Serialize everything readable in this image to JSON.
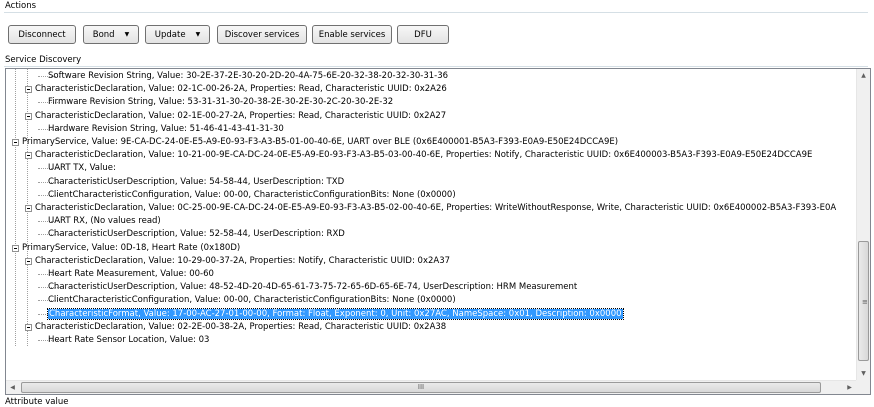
{
  "actions": {
    "label": "Actions",
    "buttons": {
      "disconnect": "Disconnect",
      "bond": "Bond",
      "update": "Update",
      "discover": "Discover services",
      "enable": "Enable services",
      "dfu": "DFU"
    }
  },
  "service_discovery": {
    "label": "Service Discovery",
    "tree": [
      {
        "level": 3,
        "text": "Software Revision String, Value: 30-2E-37-2E-30-20-2D-20-4A-75-6E-20-32-38-20-32-30-31-36",
        "toggle": false
      },
      {
        "level": 2,
        "text": "CharacteristicDeclaration, Value: 02-1C-00-26-2A, Properties: Read, Characteristic UUID: 0x2A26",
        "toggle": true
      },
      {
        "level": 3,
        "text": "Firmware Revision String, Value: 53-31-31-30-20-38-2E-30-2E-30-2C-20-30-2E-32",
        "toggle": false
      },
      {
        "level": 2,
        "text": "CharacteristicDeclaration, Value: 02-1E-00-27-2A, Properties: Read, Characteristic UUID: 0x2A27",
        "toggle": true
      },
      {
        "level": 3,
        "text": "Hardware Revision String, Value: 51-46-41-43-41-31-30",
        "toggle": false
      },
      {
        "level": 1,
        "text": "PrimaryService, Value: 9E-CA-DC-24-0E-E5-A9-E0-93-F3-A3-B5-01-00-40-6E, UART over BLE (0x6E400001-B5A3-F393-E0A9-E50E24DCCA9E)",
        "toggle": true
      },
      {
        "level": 2,
        "text": "CharacteristicDeclaration, Value: 10-21-00-9E-CA-DC-24-0E-E5-A9-E0-93-F3-A3-B5-03-00-40-6E, Properties: Notify, Characteristic UUID: 0x6E400003-B5A3-F393-E0A9-E50E24DCCA9E",
        "toggle": true
      },
      {
        "level": 3,
        "text": "UART TX, Value:",
        "toggle": false
      },
      {
        "level": 3,
        "text": "CharacteristicUserDescription, Value: 54-58-44, UserDescription: TXD",
        "toggle": false
      },
      {
        "level": 3,
        "text": "ClientCharacteristicConfiguration, Value: 00-00, CharacteristicConfigurationBits: None (0x0000)",
        "toggle": false
      },
      {
        "level": 2,
        "text": "CharacteristicDeclaration, Value: 0C-25-00-9E-CA-DC-24-0E-E5-A9-E0-93-F3-A3-B5-02-00-40-6E, Properties: WriteWithoutResponse, Write, Characteristic UUID: 0x6E400002-B5A3-F393-E0A",
        "toggle": true
      },
      {
        "level": 3,
        "text": "UART RX, (No values read)",
        "toggle": false
      },
      {
        "level": 3,
        "text": "CharacteristicUserDescription, Value: 52-58-44, UserDescription: RXD",
        "toggle": false
      },
      {
        "level": 1,
        "text": "PrimaryService, Value: 0D-18, Heart Rate (0x180D)",
        "toggle": true
      },
      {
        "level": 2,
        "text": "CharacteristicDeclaration, Value: 10-29-00-37-2A, Properties: Notify, Characteristic UUID: 0x2A37",
        "toggle": true
      },
      {
        "level": 3,
        "text": "Heart Rate Measurement, Value: 00-60",
        "toggle": false
      },
      {
        "level": 3,
        "text": "CharacteristicUserDescription, Value: 48-52-4D-20-4D-65-61-73-75-72-65-6D-65-6E-74, UserDescription: HRM Measurement",
        "toggle": false
      },
      {
        "level": 3,
        "text": "ClientCharacteristicConfiguration, Value: 00-00, CharacteristicConfigurationBits: None (0x0000)",
        "toggle": false
      },
      {
        "level": 3,
        "text": "CharacteristicFormat, Value: 17-00-AC-27-01-00-00, Format: Float, Exponent: 0, Unit: 0x27AC, NameSpace: 0x01, Description: 0x0000",
        "toggle": false,
        "selected": true
      },
      {
        "level": 2,
        "text": "CharacteristicDeclaration, Value: 02-2E-00-38-2A, Properties: Read, Characteristic UUID: 0x2A38",
        "toggle": true
      },
      {
        "level": 3,
        "text": "Heart Rate Sensor Location, Value: 03",
        "toggle": false
      }
    ],
    "scrollbar": {
      "up": "▲",
      "down": "▼",
      "left": "◀",
      "right": "▶",
      "grip": "≡",
      "hgrip": "III"
    }
  },
  "attribute_value": {
    "label": "Attribute value"
  },
  "colors": {
    "selection": "#3399ff",
    "border": "#828790"
  }
}
